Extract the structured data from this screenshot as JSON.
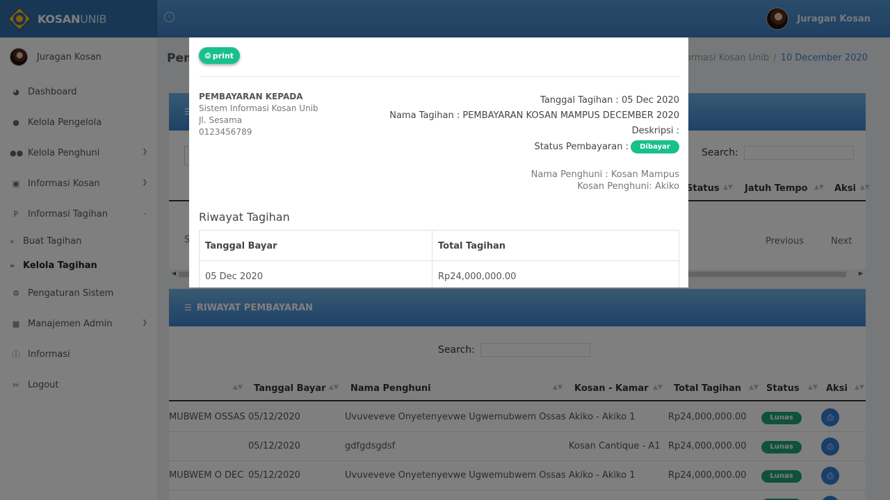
{
  "app": {
    "brand_bold": "KOSAN",
    "brand_light": "UNIB",
    "user_name": "Juragan Kosan"
  },
  "sidebar": {
    "user_name": "Juragan Kosan",
    "items": [
      {
        "label": "Dashboard",
        "icon": "dashboard-icon"
      },
      {
        "label": "Kelola Pengelola",
        "icon": "user-icon"
      },
      {
        "label": "Kelola Penghuni",
        "icon": "users-icon"
      },
      {
        "label": "Informasi Kosan",
        "icon": "bank-icon"
      },
      {
        "label": "Informasi Tagihan",
        "icon": "paypal-icon"
      },
      {
        "label": "Buat Tagihan",
        "icon": "double-chevron-icon"
      },
      {
        "label": "Kelola Tagihan",
        "icon": "double-chevron-icon"
      },
      {
        "label": "Pengaturan Sistem",
        "icon": "gears-icon"
      },
      {
        "label": "Manajemen Admin",
        "icon": "cubes-icon"
      },
      {
        "label": "Informasi",
        "icon": "info-icon"
      },
      {
        "label": "Logout",
        "icon": "sign-out-icon"
      }
    ]
  },
  "page": {
    "title": "Pem",
    "breadcrumb": [
      "formasi Kosan Unib",
      "10 December 2020"
    ]
  },
  "card1": {
    "search_label": "Search:",
    "columns": [
      "Status",
      "Jatuh Tempo",
      "Aksi"
    ],
    "first_cell": "S",
    "prev": "Previous",
    "next": "Next"
  },
  "card2": {
    "title": "RIWAYAT PEMBAYARAN",
    "search_label": "Search:",
    "columns": [
      "Tanggal Bayar",
      "Nama Penghuni",
      "Kosan - Kamar",
      "Total Tagihan",
      "Status",
      "Aksi"
    ],
    "rows": [
      {
        "desc": "MUBWEM OSSAS",
        "date": "05/12/2020",
        "name": "Uvuveveve Onyetenyevwe Ugwemubwem Ossas",
        "room": "Akiko - Akiko 1",
        "total": "Rp24,000,000.00",
        "status": "Lunas"
      },
      {
        "desc": "",
        "date": "05/12/2020",
        "name": "gdfgdsgdsf",
        "room": "Kosan Cantique - A1",
        "total": "Rp24,000,000.00",
        "status": "Lunas"
      },
      {
        "desc": "MUBWEM O DEC",
        "date": "05/12/2020",
        "name": "Uvuveveve Onyetenyevwe Ugwemubwem Ossas",
        "room": "Akiko - Akiko 1",
        "total": "Rp24,000,000.00",
        "status": "Lunas"
      }
    ]
  },
  "modal": {
    "print_label": "print",
    "payto_heading": "PEMBAYARAN KEPADA",
    "payto_lines": [
      "Sistem Informasi Kosan Unib",
      "Jl. Sesama",
      "0123456789"
    ],
    "tanggal": "Tanggal Tagihan : 05 Dec 2020",
    "nama_tagihan": "Nama Tagihan : PEMBAYARAN KOSAN MAMPUS DECEMBER 2020",
    "deskripsi": "Deskripsi :",
    "status_label": "Status Pembayaran :",
    "status_value": "Dibayar",
    "nama_penghuni": "Nama Penghuni : Kosan Mampus",
    "kosan_penghuni": "Kosan Penghuni: Akiko",
    "history_title": "Riwayat Tagihan",
    "history_columns": [
      "Tanggal Bayar",
      "Total Tagihan"
    ],
    "history_rows": [
      {
        "date": "05 Dec 2020",
        "total": "Rp24,000,000.00"
      }
    ]
  },
  "colors": {
    "header": "#3e7fc0",
    "badge_green": "#1fa27a",
    "print_green": "#19c08c",
    "action_blue": "#2e7fd2",
    "overlay": "rgba(0,0,0,0.5)"
  }
}
